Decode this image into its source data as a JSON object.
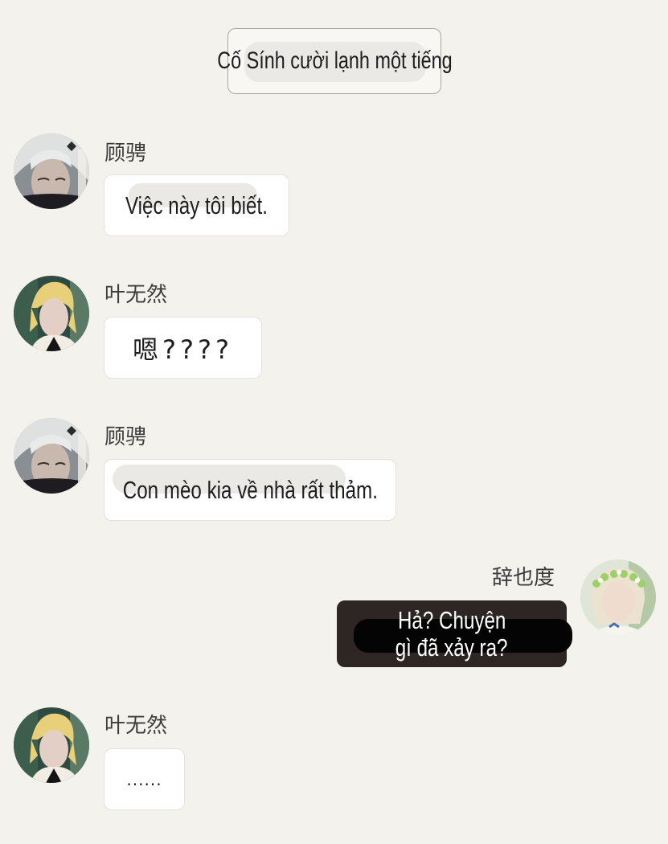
{
  "chat": {
    "narration": "Cố Sính cười lạnh một tiếng",
    "messages": [
      {
        "sender": "顾骋",
        "text": "Việc này tôi biết.",
        "avatar": "avatar-silver-hair-man"
      },
      {
        "sender": "叶无然",
        "text": "嗯????",
        "avatar": "avatar-blonde-man"
      },
      {
        "sender": "顾骋",
        "text": "Con mèo kia về nhà rất thảm.",
        "avatar": "avatar-silver-hair-man"
      },
      {
        "sender": "辞也度",
        "text_line1": "Hả? Chuyện",
        "text_line2": "gì đã xảy ra?",
        "avatar": "avatar-flower-crown"
      },
      {
        "sender": "叶无然",
        "text": "......",
        "avatar": "avatar-blonde-man"
      }
    ]
  },
  "colors": {
    "background": "#f4f2ec",
    "bubble_light": "#ffffff",
    "bubble_dark": "#2e2625",
    "name_text": "#3c3c3c"
  }
}
